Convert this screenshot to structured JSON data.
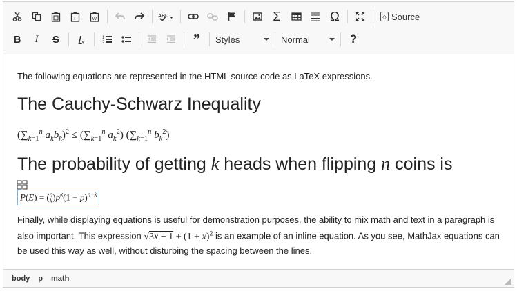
{
  "toolbar": {
    "row1": [
      {
        "icon": "cut-icon",
        "glyph": "✂",
        "enabled": true
      },
      {
        "icon": "copy-icon",
        "glyph": "⧉",
        "enabled": true
      },
      {
        "icon": "paste-icon",
        "glyph": "📋",
        "enabled": true
      },
      {
        "icon": "paste-text-icon",
        "glyph": "📋",
        "enabled": true
      },
      {
        "icon": "paste-word-icon",
        "glyph": "📋",
        "enabled": true
      },
      {
        "icon": "undo-icon",
        "glyph": "↶",
        "enabled": false
      },
      {
        "icon": "redo-icon",
        "glyph": "↷",
        "enabled": true
      },
      {
        "icon": "spellcheck-icon",
        "glyph": "ABC✓",
        "enabled": true
      },
      {
        "icon": "link-icon",
        "glyph": "🔗",
        "enabled": true
      },
      {
        "icon": "unlink-icon",
        "glyph": "⛓",
        "enabled": false
      },
      {
        "icon": "anchor-flag-icon",
        "glyph": "⚑",
        "enabled": true
      },
      {
        "icon": "image-icon",
        "glyph": "▨",
        "enabled": true
      },
      {
        "icon": "math-sigma-icon",
        "glyph": "Σ",
        "enabled": true
      },
      {
        "icon": "table-icon",
        "glyph": "⊞",
        "enabled": true
      },
      {
        "icon": "horizontal-line-icon",
        "glyph": "≣",
        "enabled": true
      },
      {
        "icon": "special-char-omega-icon",
        "glyph": "Ω",
        "enabled": true
      },
      {
        "icon": "maximize-icon",
        "glyph": "⤢",
        "enabled": true
      }
    ],
    "source_label": "Source",
    "row2": [
      {
        "icon": "bold-icon",
        "glyph": "B",
        "enabled": true
      },
      {
        "icon": "italic-icon",
        "glyph": "I",
        "enabled": true
      },
      {
        "icon": "strikethrough-icon",
        "glyph": "S",
        "enabled": true
      },
      {
        "icon": "remove-format-icon",
        "glyph": "Tx",
        "enabled": true
      },
      {
        "icon": "numbered-list-icon",
        "glyph": "⒈",
        "enabled": true
      },
      {
        "icon": "bulleted-list-icon",
        "glyph": "•",
        "enabled": true
      },
      {
        "icon": "outdent-icon",
        "glyph": "⇤",
        "enabled": false
      },
      {
        "icon": "indent-icon",
        "glyph": "⇥",
        "enabled": false
      },
      {
        "icon": "blockquote-icon",
        "glyph": "❞",
        "enabled": true
      }
    ],
    "styles_label": "Styles",
    "format_label": "Normal",
    "help_glyph": "?"
  },
  "content": {
    "intro": "The following equations are represented in the HTML source code as LaTeX expressions.",
    "heading1": "The Cauchy-Schwarz Inequality",
    "heading2_a": "The probability of getting ",
    "heading2_k": "k",
    "heading2_b": " heads when flipping ",
    "heading2_n": "n",
    "heading2_c": " coins is",
    "para_a": "Finally, while displaying equations is useful for demonstration purposes, the ability to mix math and text in a paragraph is also important. This expression ",
    "para_b": " is an example of an inline equation. As you see, MathJax equations can be used this way as well, without disturbing the spacing between the lines."
  },
  "statusbar": {
    "path": [
      "body",
      "p",
      "math"
    ]
  }
}
